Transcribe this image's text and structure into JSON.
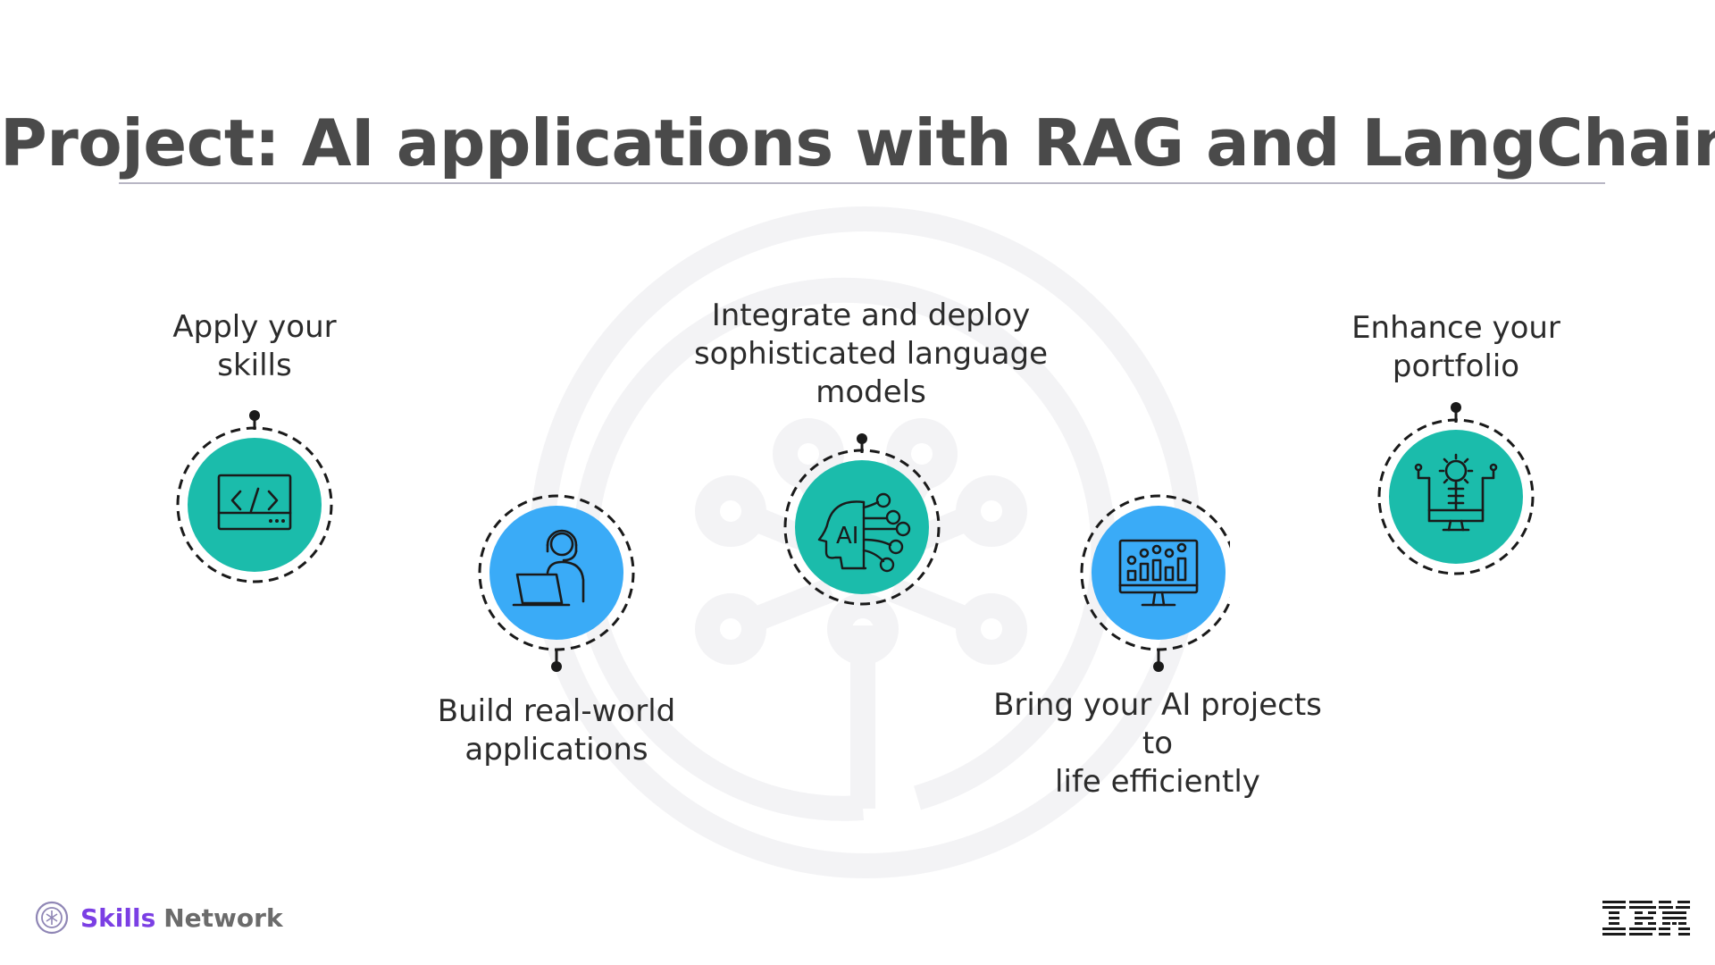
{
  "slide": {
    "title": "Project: AI applications with RAG and LangChain",
    "colors": {
      "teal": "#1bbcab",
      "blue": "#3aabf7",
      "title_text": "#4a4a4a",
      "body_text": "#2b2b2b",
      "rule": "#b8b6c4",
      "watermark": "#f3f3f5"
    }
  },
  "steps": [
    {
      "label": "Apply your\nskills",
      "icon": "code-window-icon",
      "color": "teal"
    },
    {
      "label": "Build real-world\napplications",
      "icon": "support-agent-laptop-icon",
      "color": "blue"
    },
    {
      "label": "Integrate and deploy\nsophisticated language\nmodels",
      "icon": "ai-head-network-icon",
      "color": "teal"
    },
    {
      "label": "Bring your AI projects to\nlife efficiently",
      "icon": "dashboard-monitor-icon",
      "color": "blue"
    },
    {
      "label": "Enhance your\nportfolio",
      "icon": "gear-monitor-icon",
      "color": "teal"
    }
  ],
  "footer": {
    "brand_part1": "Skills",
    "brand_part2": "Network",
    "brand_icon": "skills-network-logo-icon",
    "partner_logo": "ibm-logo"
  }
}
